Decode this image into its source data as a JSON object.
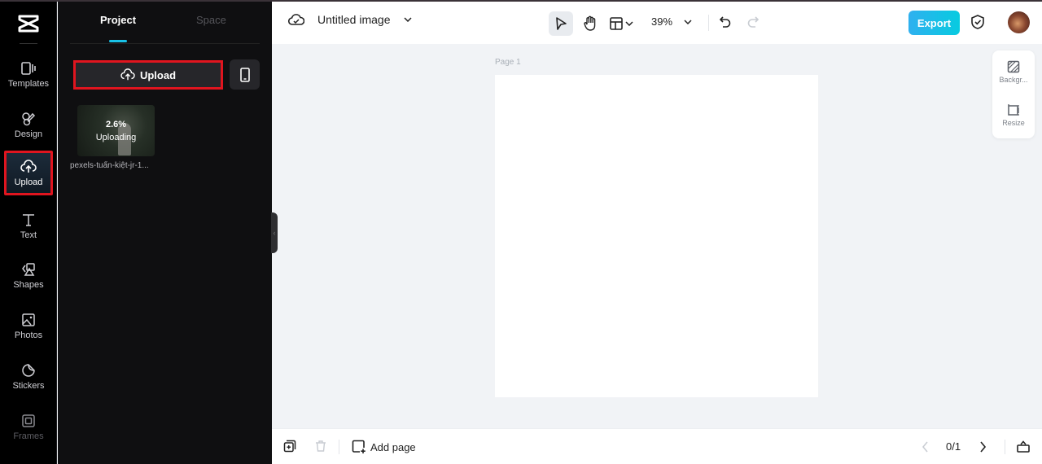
{
  "nav": {
    "items": [
      {
        "label": "Templates",
        "icon": "templates-icon"
      },
      {
        "label": "Design",
        "icon": "design-icon"
      },
      {
        "label": "Upload",
        "icon": "upload-cloud-icon",
        "active": true
      },
      {
        "label": "Text",
        "icon": "text-icon"
      },
      {
        "label": "Shapes",
        "icon": "shapes-icon"
      },
      {
        "label": "Photos",
        "icon": "photos-icon"
      },
      {
        "label": "Stickers",
        "icon": "stickers-icon"
      },
      {
        "label": "Frames",
        "icon": "frames-icon"
      }
    ]
  },
  "panel": {
    "tabs": [
      {
        "label": "Project",
        "active": true
      },
      {
        "label": "Space"
      }
    ],
    "upload_label": "Upload",
    "uploads": [
      {
        "progress": "2.6%",
        "status": "Uploading",
        "name": "pexels-tuấn-kiệt-jr-1..."
      }
    ]
  },
  "header": {
    "title": "Untitled image",
    "zoom": "39%",
    "export_label": "Export"
  },
  "canvas": {
    "page_label": "Page 1",
    "side_tools": [
      {
        "label": "Backgr..."
      },
      {
        "label": "Resize"
      }
    ]
  },
  "footer": {
    "add_page_label": "Add page",
    "pager": "0/1"
  },
  "colors": {
    "accent": "#19c1e6",
    "export_gradient_start": "#2fb0ef",
    "export_gradient_end": "#07cbe0",
    "highlight": "#e0151f"
  }
}
